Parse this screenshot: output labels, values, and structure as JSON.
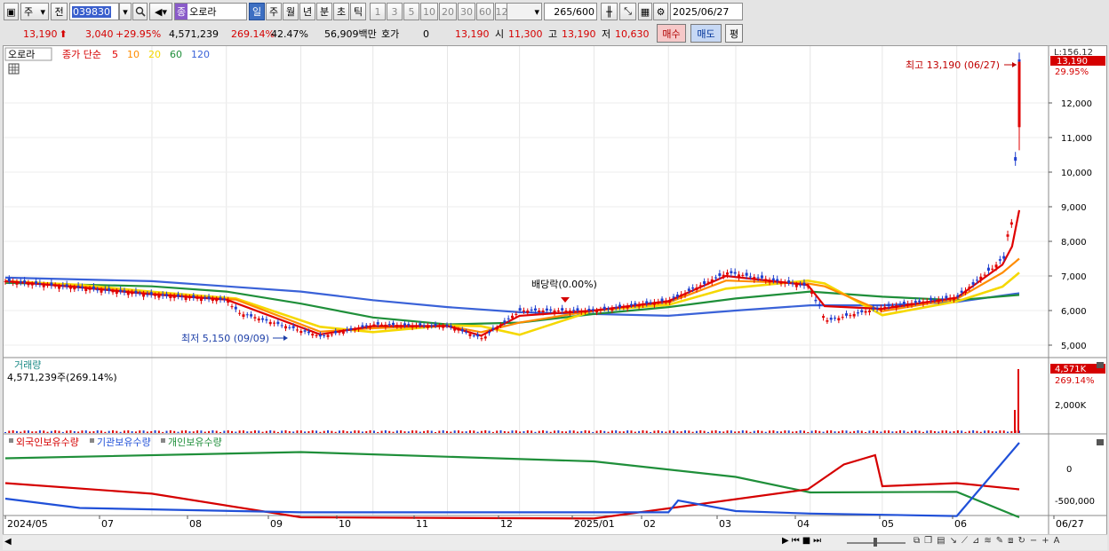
{
  "toolbar": {
    "mode_label": "주",
    "prev_label": "전",
    "code_value": "039830",
    "name_badge": "종",
    "name_value": "오로라",
    "periods": [
      "일",
      "주",
      "월",
      "년",
      "분",
      "초",
      "틱"
    ],
    "active_period": "일",
    "minutes": [
      "1",
      "3",
      "5",
      "10",
      "20",
      "30",
      "60",
      "120"
    ],
    "count_value": "265",
    "count_total": "/600",
    "date_value": "2025/06/27"
  },
  "quote": {
    "price": "13,190",
    "change": "3,040",
    "change_pct": "+29.95%",
    "volume": "4,571,239",
    "vol_ratio": "269.14%",
    "turnover": "42.47%",
    "amount": "56,909백만",
    "hoga_label": "호가",
    "hoga_value": "0",
    "hoga_price": "13,190",
    "open_label": "시",
    "open_value": "11,300",
    "high_label": "고",
    "high_value": "13,190",
    "low_label": "저",
    "low_value": "10,630",
    "buy_label": "매수",
    "sell_label": "매도",
    "eval_label": "평"
  },
  "price_panel": {
    "legend_name": "오로라",
    "legend_prefix": "종가 단순",
    "ma_periods": [
      {
        "label": "5",
        "color": "#e00000"
      },
      {
        "label": "10",
        "color": "#ff8c00"
      },
      {
        "label": "20",
        "color": "#f5d800"
      },
      {
        "label": "60",
        "color": "#1f8f3a"
      },
      {
        "label": "120",
        "color": "#3a62d8"
      }
    ],
    "axis_top_label": "L:156.12",
    "last_price_tag": "13,190",
    "last_change_tag": "29.95%",
    "high_annotation": "최고 13,190 (06/27)",
    "low_annotation": "최저 5,150 (09/09)",
    "dividend_annotation": "배당락(0.00%)",
    "y_ticks": [
      {
        "value": 12000,
        "label": "12,000"
      },
      {
        "value": 11000,
        "label": "11,000"
      },
      {
        "value": 10000,
        "label": "10,000"
      },
      {
        "value": 9000,
        "label": "9,000"
      },
      {
        "value": 8000,
        "label": "8,000"
      },
      {
        "value": 7000,
        "label": "7,000"
      },
      {
        "value": 6000,
        "label": "6,000"
      },
      {
        "value": 5000,
        "label": "5,000"
      }
    ]
  },
  "volume_panel": {
    "title": "거래량",
    "info": "4,571,239주(269.14%)",
    "tag_value": "4,571K",
    "tag_pct": "269.14%",
    "y_tick_label": "2,000K"
  },
  "holdings_panel": {
    "legend": [
      {
        "label": "외국인보유수량",
        "color": "#d50000"
      },
      {
        "label": "기관보유수량",
        "color": "#2050d8"
      },
      {
        "label": "개인보유수량",
        "color": "#1f8f3a"
      }
    ],
    "y_ticks": [
      "0",
      "-500,000"
    ]
  },
  "x_labels": [
    "2024/05",
    "07",
    "08",
    "09",
    "10",
    "11",
    "12",
    "2025/01",
    "02",
    "03",
    "04",
    "05",
    "06",
    "06/27"
  ],
  "chart_data": {
    "type": "line",
    "title": "오로라",
    "x_range": [
      "2024/05",
      "2025/06/27"
    ],
    "series": [
      {
        "name": "종가",
        "points": [
          [
            "2024/05",
            6850
          ],
          [
            "2024/06",
            6650
          ],
          [
            "2024/07",
            6450
          ],
          [
            "2024/08",
            6300
          ],
          [
            "2024/08/05",
            5950
          ],
          [
            "2024/09/09",
            5250
          ],
          [
            "2024/10",
            5600
          ],
          [
            "2024/11",
            5550
          ],
          [
            "2024/11/15",
            5200
          ],
          [
            "2024/12",
            6000
          ],
          [
            "2025/01",
            6000
          ],
          [
            "2025/02",
            6300
          ],
          [
            "2025/02/25",
            7100
          ],
          [
            "2025/03/31",
            6700
          ],
          [
            "2025/04/07",
            5700
          ],
          [
            "2025/05",
            6100
          ],
          [
            "2025/06",
            6400
          ],
          [
            "2025/06/20",
            7500
          ],
          [
            "2025/06/24",
            8900
          ],
          [
            "2025/06/27",
            13190
          ]
        ]
      },
      {
        "name": "60",
        "points": [
          [
            "2024/05",
            6800
          ],
          [
            "2024/07",
            6700
          ],
          [
            "2024/08",
            6550
          ],
          [
            "2024/09",
            6200
          ],
          [
            "2024/10",
            5800
          ],
          [
            "2024/11",
            5600
          ],
          [
            "2024/12",
            5650
          ],
          [
            "2025/01",
            5900
          ],
          [
            "2025/02",
            6100
          ],
          [
            "2025/03",
            6350
          ],
          [
            "2025/04",
            6550
          ],
          [
            "2025/05",
            6400
          ],
          [
            "2025/06",
            6300
          ],
          [
            "2025/06/27",
            6450
          ]
        ]
      },
      {
        "name": "120",
        "points": [
          [
            "2024/05",
            6950
          ],
          [
            "2024/07",
            6850
          ],
          [
            "2024/08",
            6700
          ],
          [
            "2024/09",
            6550
          ],
          [
            "2024/10",
            6300
          ],
          [
            "2024/11",
            6100
          ],
          [
            "2024/12",
            5950
          ],
          [
            "2025/01",
            5900
          ],
          [
            "2025/02",
            5850
          ],
          [
            "2025/03",
            6000
          ],
          [
            "2025/04",
            6150
          ],
          [
            "2025/05",
            6150
          ],
          [
            "2025/06",
            6250
          ],
          [
            "2025/06/27",
            6500
          ]
        ]
      },
      {
        "name": "외국인보유수량",
        "points": [
          [
            "2024/05",
            -250000
          ],
          [
            "2024/07",
            -420000
          ],
          [
            "2024/09",
            -800000
          ],
          [
            "2025/01",
            -820000
          ],
          [
            "2025/03/31",
            -350000
          ],
          [
            "2025/04/15",
            50000
          ],
          [
            "2025/04/28",
            200000
          ],
          [
            "2025/05",
            -300000
          ],
          [
            "2025/06",
            -250000
          ],
          [
            "2025/06/27",
            -350000
          ]
        ]
      },
      {
        "name": "기관보유수량",
        "points": [
          [
            "2024/05",
            -500000
          ],
          [
            "2024/06",
            -650000
          ],
          [
            "2024/09",
            -720000
          ],
          [
            "2025/02",
            -720000
          ],
          [
            "2025/02/05",
            -530000
          ],
          [
            "2025/03",
            -700000
          ],
          [
            "2025/04",
            -740000
          ],
          [
            "2025/06",
            -780000
          ],
          [
            "2025/06/27",
            400000
          ]
        ]
      },
      {
        "name": "개인보유수량",
        "points": [
          [
            "2024/05",
            150000
          ],
          [
            "2024/09",
            250000
          ],
          [
            "2025/01",
            100000
          ],
          [
            "2025/03",
            -150000
          ],
          [
            "2025/04",
            -400000
          ],
          [
            "2025/06",
            -390000
          ],
          [
            "2025/06/27",
            -800000
          ]
        ]
      }
    ]
  }
}
